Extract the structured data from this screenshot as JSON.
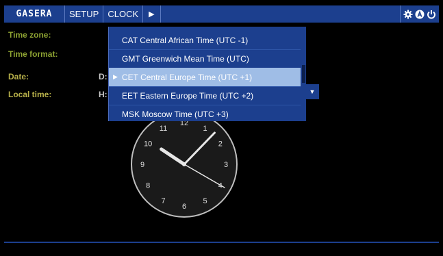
{
  "topbar": {
    "logo": "GASERA",
    "menu": [
      "SETUP",
      "CLOCK"
    ],
    "play_icon": "▶",
    "icons": [
      "gear-icon",
      "a-circle-icon",
      "power-icon"
    ]
  },
  "labels": {
    "time_zone": "Time zone:",
    "time_format": "Time format:",
    "date": "Date:",
    "local_time": "Local time:",
    "date_prefix": "D:",
    "time_prefix": "H:"
  },
  "dropdown": {
    "items": [
      "CAT Central African Time (UTC -1)",
      "GMT Greenwich Mean Time (UTC)",
      "CET Central Europe Time (UTC +1)",
      "EET Eastern Europe Time (UTC +2)",
      "MSK Moscow Time (UTC +3)"
    ],
    "selected_index": 2,
    "marker": "▶",
    "arrow": "▼"
  },
  "clock": {
    "numbers": [
      "12",
      "1",
      "2",
      "3",
      "4",
      "5",
      "6",
      "7",
      "8",
      "9",
      "10",
      "11"
    ],
    "hour": 10,
    "minute": 7,
    "second": 20
  },
  "colors": {
    "bar": "#1c3f8e",
    "label": "#8ea332",
    "selected": "#9fbde6"
  }
}
